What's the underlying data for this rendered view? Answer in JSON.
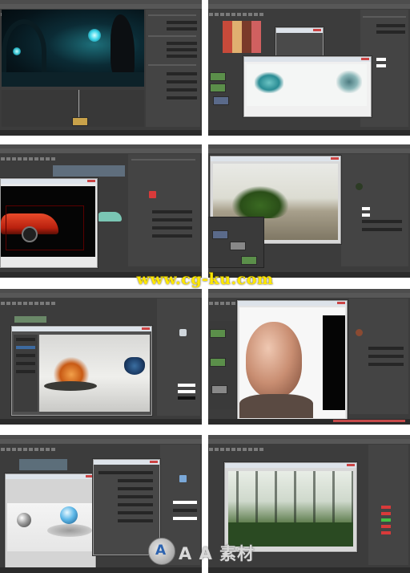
{
  "watermark": {
    "text": "www.cg-ku.com"
  },
  "logo": {
    "mark": "A",
    "text": "A A 素材"
  },
  "colors": {
    "ui_dark": "#3c3c3c",
    "ui_panel": "#444444",
    "timeline_red": "#c64a4a",
    "watermark_yellow": "#ffe800"
  },
  "tiles": [
    {
      "scene": "dark blue cave render with glowing orbs"
    },
    {
      "scene": "node editor with crystal splash render window"
    },
    {
      "scene": "red sports car render"
    },
    {
      "scene": "fern plant on desert ground render"
    },
    {
      "scene": "orange fluid and blue bowl render"
    },
    {
      "scene": "bald man portrait render"
    },
    {
      "scene": "chrome and glass spheres render"
    },
    {
      "scene": "forest render with dark trees"
    }
  ]
}
